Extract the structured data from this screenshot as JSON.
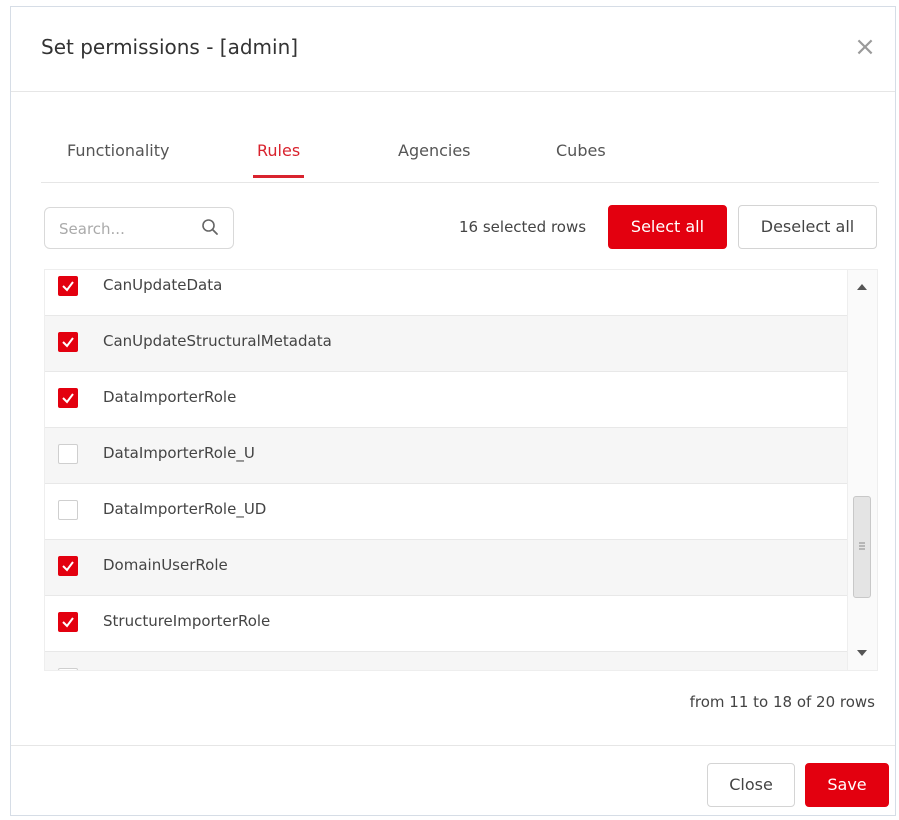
{
  "dialog": {
    "title": "Set permissions - [admin]",
    "close_glyph": "×"
  },
  "tabs": [
    {
      "label": "Functionality",
      "active": false
    },
    {
      "label": "Rules",
      "active": true
    },
    {
      "label": "Agencies",
      "active": false
    },
    {
      "label": "Cubes",
      "active": false
    }
  ],
  "toolbar": {
    "search_placeholder": "Search...",
    "selected_text": "16 selected rows",
    "select_all_label": "Select all",
    "deselect_all_label": "Deselect all"
  },
  "rows": [
    {
      "label": "CanUpdateData",
      "checked": true
    },
    {
      "label": "CanUpdateStructuralMetadata",
      "checked": true
    },
    {
      "label": "DataImporterRole",
      "checked": true
    },
    {
      "label": "DataImporterRole_U",
      "checked": false
    },
    {
      "label": "DataImporterRole_UD",
      "checked": false
    },
    {
      "label": "DomainUserRole",
      "checked": true
    },
    {
      "label": "StructureImporterRole",
      "checked": true
    }
  ],
  "pagination_text": "from 11 to 18 of 20 rows",
  "footer": {
    "close_label": "Close",
    "save_label": "Save"
  },
  "colors": {
    "accent": "#e3000f",
    "tab_active": "#d9232e"
  },
  "icons": {
    "search": "search-icon",
    "close": "close-icon",
    "check": "check-icon"
  }
}
